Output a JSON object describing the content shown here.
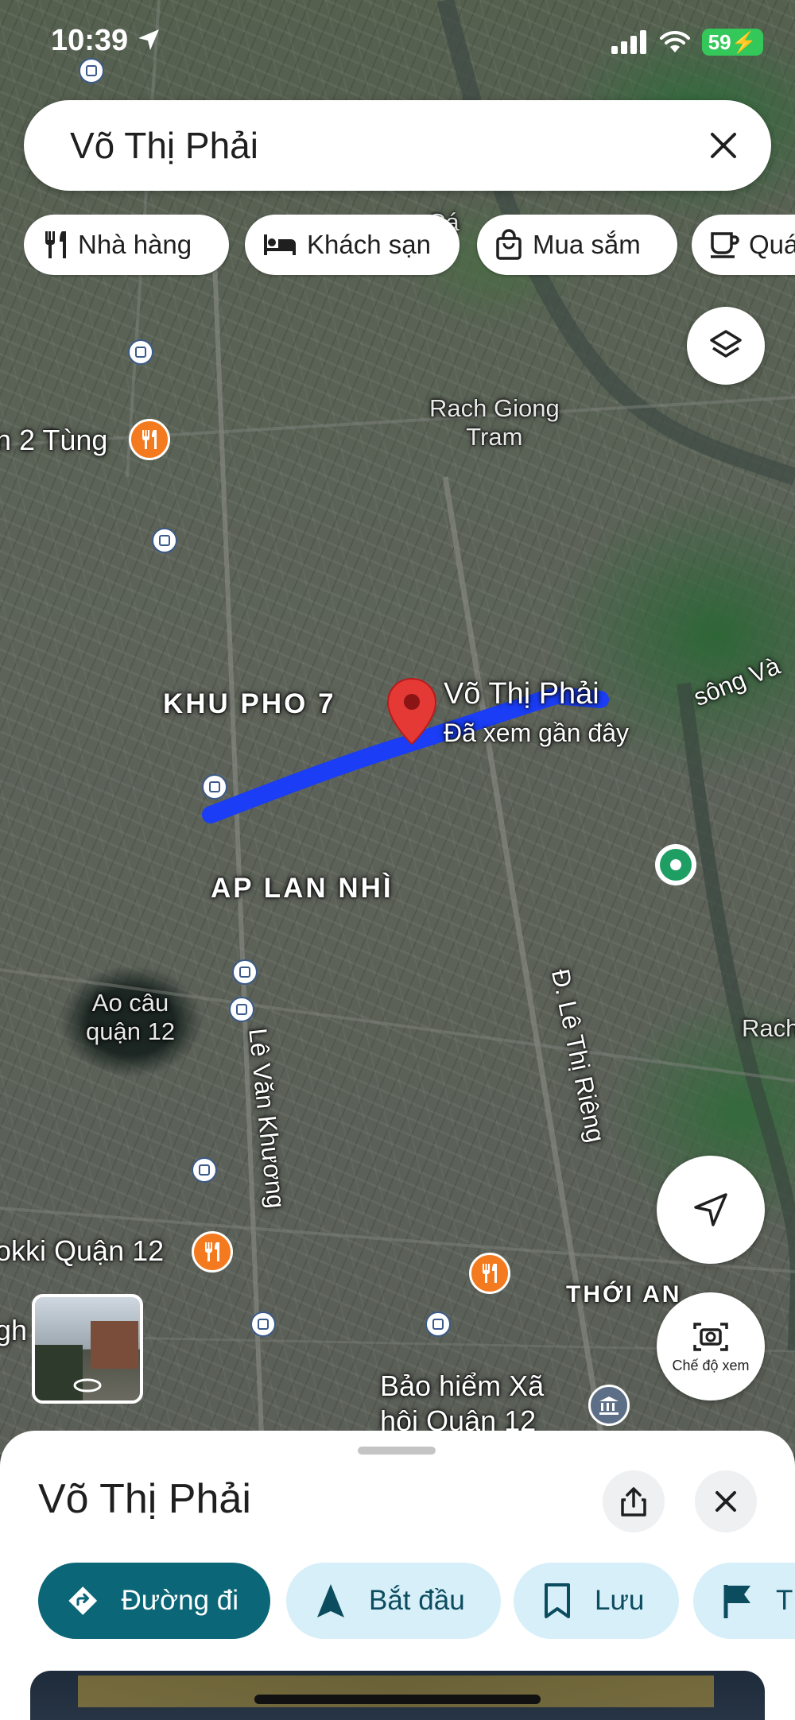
{
  "status_bar": {
    "time": "10:39",
    "battery": "59"
  },
  "search": {
    "query": "Võ Thị Phải"
  },
  "chips": [
    {
      "label": "Nhà hàng",
      "icon": "restaurant-icon"
    },
    {
      "label": "Khách sạn",
      "icon": "hotel-icon"
    },
    {
      "label": "Mua sắm",
      "icon": "shopping-bag-icon"
    },
    {
      "label": "Quá",
      "icon": "coffee-icon"
    }
  ],
  "map": {
    "area_labels": {
      "khu_pho": "KHU PHO 7",
      "ap_lan_nhi": "AP LAN NHÌ",
      "thoi_an": "THỚI AN"
    },
    "places": {
      "rach_giong": "Rach Giong\nTram",
      "ao_cau": "Ao câu\nquận 12",
      "tung": "n 2 Tùng",
      "okki": "okki Quận 12",
      "bao_hiem": "Bảo hiểm Xã\nhội Quận 12",
      "song": "sông Và",
      "rach": "Rach",
      "gh": "gh",
      "partial_top": "Cá"
    },
    "streets": {
      "le_van_khuong": "Lê Văn Khương",
      "le_thi_rieng": "Đ. Lê Thị Riêng"
    },
    "pin": {
      "title": "Võ Thị Phải",
      "subtitle": "Đã xem gần đây"
    },
    "view_mode_label": "Chế độ xem",
    "route_color": "#1a3df5"
  },
  "sheet": {
    "title": "Võ Thị Phải",
    "actions": [
      {
        "label": "Đường đi",
        "icon": "directions-icon"
      },
      {
        "label": "Bắt đầu",
        "icon": "navigation-arrow-icon"
      },
      {
        "label": "Lưu",
        "icon": "bookmark-icon"
      },
      {
        "label": "T",
        "icon": "flag-icon"
      }
    ]
  },
  "colors": {
    "accent": "#0b6678",
    "action_bg": "#d7eff9",
    "pin": "#e53935",
    "poi": "#f47a1f",
    "battery": "#34c759"
  }
}
